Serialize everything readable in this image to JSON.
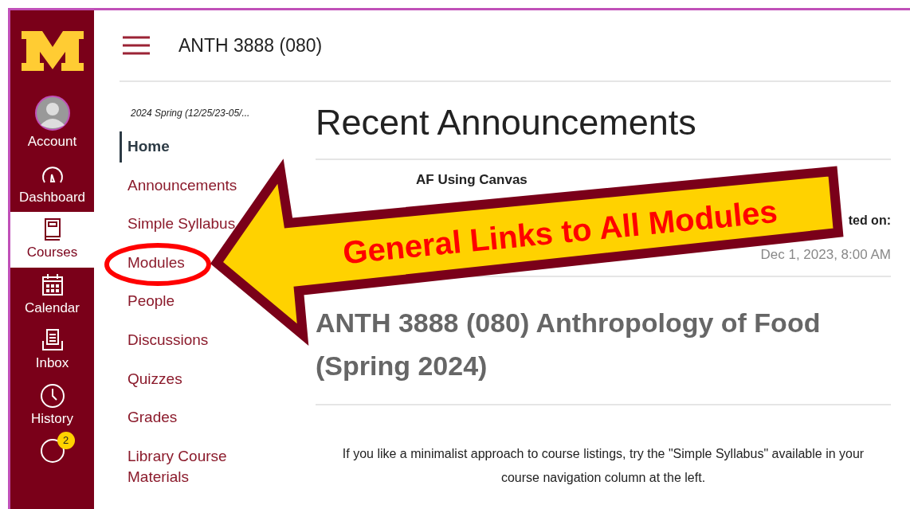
{
  "global_nav": {
    "items": [
      {
        "kind": "account",
        "label": "Account",
        "selected": false
      },
      {
        "kind": "dashboard",
        "label": "Dashboard",
        "selected": false
      },
      {
        "kind": "courses",
        "label": "Courses",
        "selected": true
      },
      {
        "kind": "calendar",
        "label": "Calendar",
        "selected": false
      },
      {
        "kind": "inbox",
        "label": "Inbox",
        "selected": false
      },
      {
        "kind": "history",
        "label": "History",
        "selected": false
      },
      {
        "kind": "help",
        "badge": "2",
        "selected": false
      }
    ]
  },
  "header": {
    "course_code": "ANTH 3888 (080)"
  },
  "course_nav": {
    "term": "2024 Spring (12/25/23-05/...",
    "items": [
      {
        "label": "Home",
        "selected": true,
        "circled": false
      },
      {
        "label": "Announcements",
        "selected": false,
        "circled": false
      },
      {
        "label": "Simple Syllabus",
        "selected": false,
        "circled": false
      },
      {
        "label": "Modules",
        "selected": false,
        "circled": true
      },
      {
        "label": "People",
        "selected": false,
        "circled": false
      },
      {
        "label": "Discussions",
        "selected": false,
        "circled": false
      },
      {
        "label": "Quizzes",
        "selected": false,
        "circled": false
      },
      {
        "label": "Grades",
        "selected": false,
        "circled": false
      },
      {
        "label": "Library Course Materials",
        "selected": false,
        "circled": false
      }
    ]
  },
  "announcements": {
    "heading": "Recent Announcements",
    "items": [
      {
        "title": "AF Using Canvas",
        "posted_label": "ted on:",
        "posted_date": "Dec 1, 2023, 8:00 AM"
      }
    ]
  },
  "course_title": "ANTH 3888 (080) Anthropology of Food (Spring 2024)",
  "intro": "If you like a minimalist approach to course listings, try the \"Simple Syllabus\" available in your course navigation column at the left.",
  "callout": {
    "text": "General Links to All Modules"
  }
}
